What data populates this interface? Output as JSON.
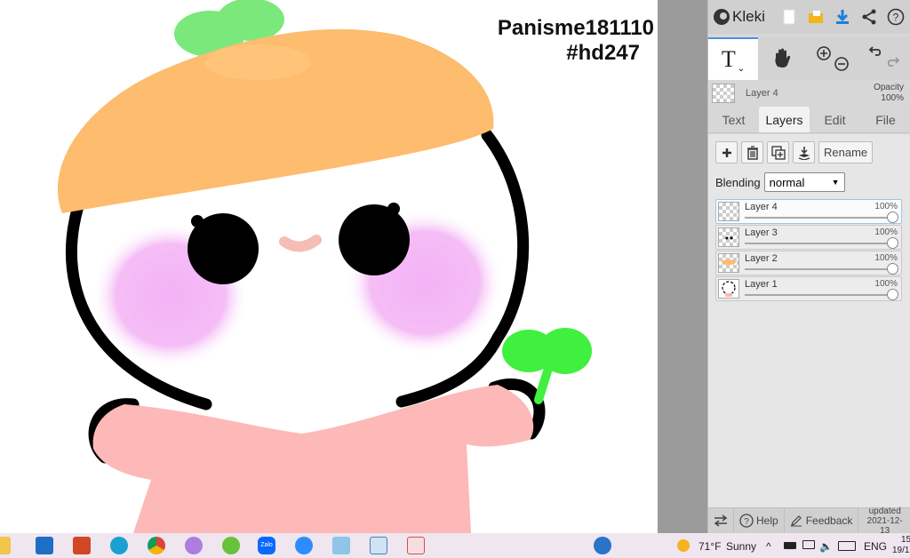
{
  "canvas": {
    "watermark_line1": "Panisme181110",
    "watermark_line2": "#hd247"
  },
  "app": {
    "logo_text": "Kleki",
    "accent_color": "#1e7fd8"
  },
  "toolbar": {
    "text_tool_glyph": "T",
    "icons": [
      "new-file-icon",
      "open-folder-icon",
      "download-icon",
      "share-icon",
      "help-icon"
    ]
  },
  "layer_info": {
    "name": "Layer 4",
    "opacity_label": "Opacity",
    "opacity_value": "100%"
  },
  "tabs": [
    "Text",
    "Layers",
    "Edit",
    "File"
  ],
  "active_tab": "Layers",
  "layers_panel": {
    "rename_label": "Rename",
    "blending_label": "Blending",
    "blending_value": "normal",
    "layers": [
      {
        "name": "Layer 4",
        "opacity": "100%",
        "selected": true
      },
      {
        "name": "Layer 3",
        "opacity": "100%",
        "selected": false
      },
      {
        "name": "Layer 2",
        "opacity": "100%",
        "selected": false
      },
      {
        "name": "Layer 1",
        "opacity": "100%",
        "selected": false
      }
    ]
  },
  "footer": {
    "help_label": "Help",
    "feedback_label": "Feedback",
    "updated_label": "updated",
    "updated_date": "2021-12-13"
  },
  "taskbar": {
    "weather_temp": "71°F",
    "weather_text": "Sunny",
    "language": "ENG",
    "clock_top": "15",
    "clock_bottom": "19/1",
    "zalo_label": "Zalo"
  }
}
